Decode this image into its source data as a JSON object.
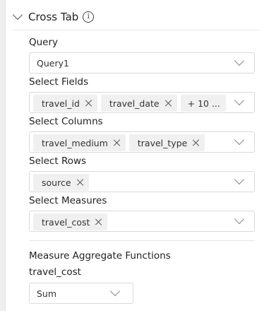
{
  "panel": {
    "title": "Cross Tab",
    "info_icon_glyph": "i"
  },
  "query": {
    "label": "Query",
    "value": "Query1"
  },
  "select_fields": {
    "label": "Select Fields",
    "chips": [
      "travel_id",
      "travel_date"
    ],
    "more_label": "+ 10 ..."
  },
  "select_columns": {
    "label": "Select Columns",
    "chips": [
      "travel_medium",
      "travel_type"
    ]
  },
  "select_rows": {
    "label": "Select Rows",
    "chips": [
      "source"
    ]
  },
  "select_measures": {
    "label": "Select Measures",
    "chips": [
      "travel_cost"
    ]
  },
  "aggregates": {
    "section_label": "Measure Aggregate Functions",
    "measure_label": "travel_cost",
    "function_value": "Sum"
  },
  "icons": {
    "collapse": "chevron-down-icon",
    "info": "info-icon",
    "remove": "close-icon",
    "dropdown": "chevron-down-icon"
  }
}
